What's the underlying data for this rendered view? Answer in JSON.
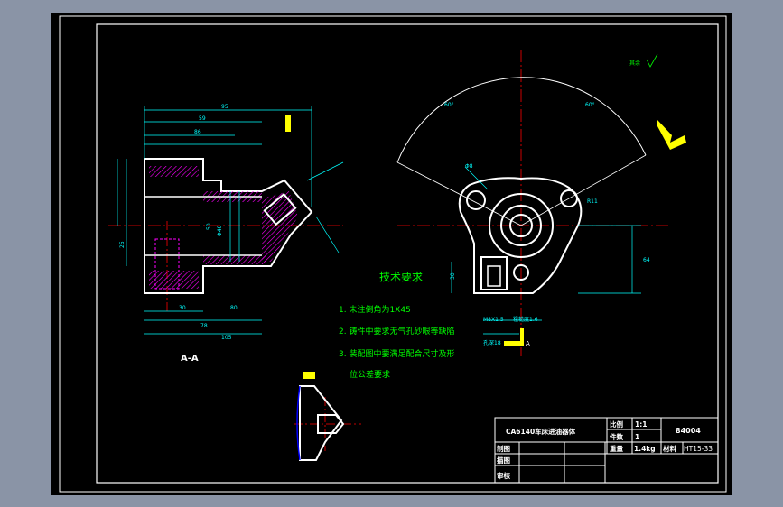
{
  "drawing": {
    "section_label": "A-A",
    "tech_title": "技术要求",
    "tech_notes": [
      "1. 未注倒角为1X45",
      "2. 铸件中要求无气孔砂眼等缺陷",
      "3. 装配图中要满足配合尺寸及形",
      "位公差要求"
    ],
    "roughness_note": "其余",
    "view_label_a": "A",
    "surface_note_1": "M8X1.5",
    "surface_note_2": "粗糙度1.6",
    "surface_note_3": "孔深18",
    "dims": {
      "d95": "95",
      "d59": "59",
      "d86": "86",
      "d30": "30",
      "d80": "80",
      "d78": "78",
      "d105": "105",
      "d50": "50",
      "d30b": "30",
      "r11": "R11",
      "d8": "Φ8",
      "d64": "64",
      "d60": "60°",
      "d60b": "60°",
      "dphi": "Φ40",
      "d25": "25"
    }
  },
  "title_block": {
    "part_name": "CA6140车床进油器体",
    "scale_label": "比例",
    "scale_value": "1:1",
    "qty_label": "件数",
    "qty_value": "1",
    "drawing_no": "84004",
    "weight_label": "重量",
    "weight_value": "1.4kg",
    "material_label": "材料",
    "material_value": "HT15-33",
    "drawn_label": "制图",
    "drawn_label2": "描图",
    "check_label": "审核"
  },
  "colors": {
    "background": "#000000",
    "border": "#ffffff",
    "dimension": "#00ffff",
    "centerline": "#ff0000",
    "annotation": "#00ff00",
    "hatch": "#ff00ff",
    "marker": "#ffff00",
    "hidden": "#0000ff"
  }
}
